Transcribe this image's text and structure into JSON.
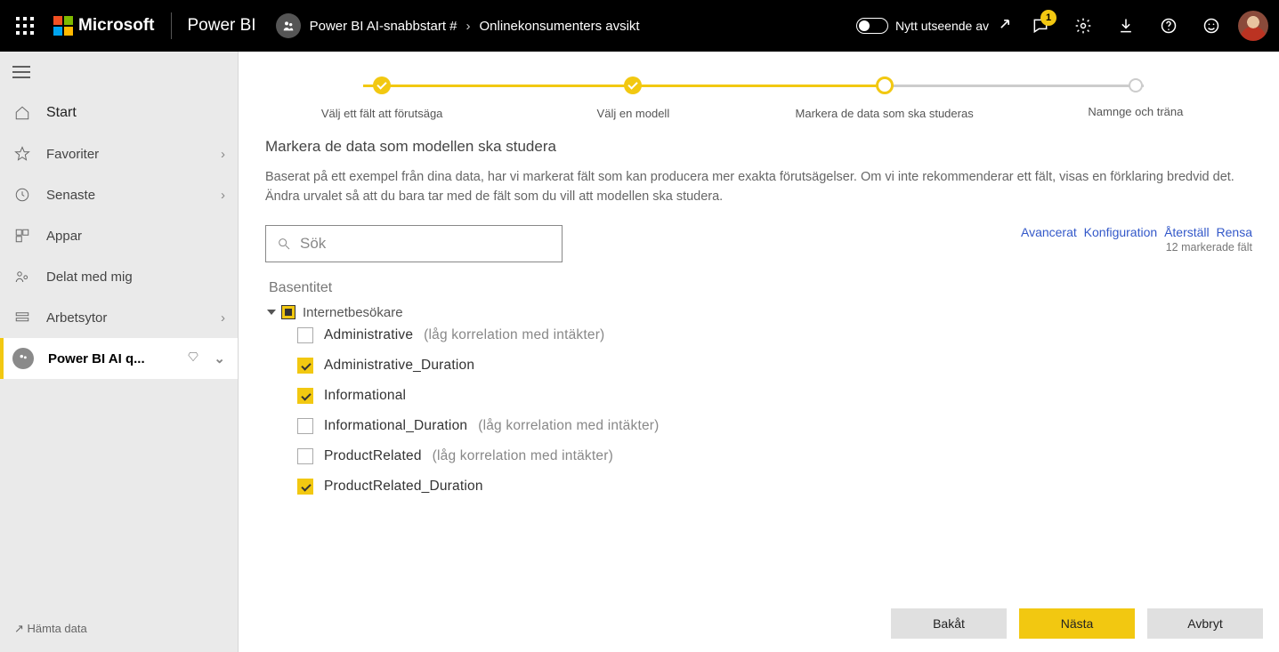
{
  "header": {
    "ms_label": "Microsoft",
    "product": "Power BI",
    "workspace": "Power BI AI-snabbstart #",
    "page": "Onlinekonsumenters avsikt",
    "toggle_label": "Nytt utseende av",
    "notification_count": "1"
  },
  "sidebar": {
    "start": "Start",
    "favorites": "Favoriter",
    "recent": "Senaste",
    "apps": "Appar",
    "shared": "Delat med mig",
    "workspaces": "Arbetsytor",
    "active_ws": "Power BI AI q...",
    "footer": "Hämta data",
    "footer_prefix": "↗"
  },
  "stepper": {
    "s1": "Välj ett fält att förutsäga",
    "s2": "Välj en modell",
    "s3": "Markera de data som ska studeras",
    "s4": "Namnge och träna"
  },
  "content": {
    "title": "Markera de data som modellen ska studera",
    "desc": "Baserat på ett exempel från dina data, har vi markerat fält som kan producera mer exakta förutsägelser. Om vi inte rekommenderar ett fält, visas en förklaring bredvid det. Ändra urvalet så att du bara tar med de fält som du vill att modellen ska studera.",
    "search_placeholder": "Sök",
    "link_advanced": "Avancerat",
    "link_config": "Konfiguration",
    "link_reset": "Återställ",
    "link_clear": "Rensa",
    "count_label": "12 markerade fält",
    "base_label": "Basentitet",
    "root": "Internetbesökare",
    "items": [
      {
        "label": "Administrative",
        "hint": "(låg korrelation med intäkter)",
        "checked": false
      },
      {
        "label": "Administrative_Duration",
        "hint": "",
        "checked": true
      },
      {
        "label": "Informational",
        "hint": "",
        "checked": true
      },
      {
        "label": "Informational_Duration",
        "hint": "(låg korrelation med intäkter)",
        "checked": false
      },
      {
        "label": "ProductRelated",
        "hint": "(låg korrelation med intäkter)",
        "checked": false
      },
      {
        "label": "ProductRelated_Duration",
        "hint": "",
        "checked": true
      }
    ]
  },
  "footer": {
    "back": "Bakåt",
    "next": "Nästa",
    "cancel": "Avbryt"
  }
}
